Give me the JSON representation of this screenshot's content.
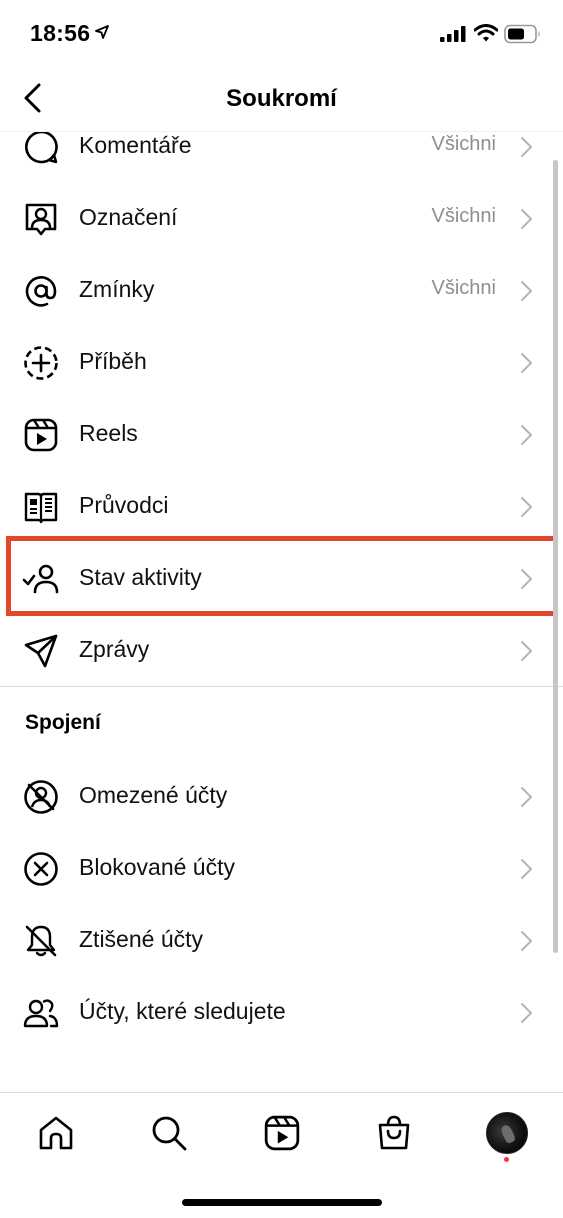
{
  "status_bar": {
    "time": "18:56"
  },
  "header": {
    "title": "Soukromí"
  },
  "rows": [
    {
      "label": "Komentáře",
      "value": "Všichni",
      "icon": "comment-icon"
    },
    {
      "label": "Označení",
      "value": "Všichni",
      "icon": "tag-person-icon"
    },
    {
      "label": "Zmínky",
      "value": "Všichni",
      "icon": "at-icon"
    },
    {
      "label": "Příběh",
      "value": "",
      "icon": "story-add-icon"
    },
    {
      "label": "Reels",
      "value": "",
      "icon": "reels-icon"
    },
    {
      "label": "Průvodci",
      "value": "",
      "icon": "guides-icon"
    },
    {
      "label": "Stav aktivity",
      "value": "",
      "icon": "activity-status-icon"
    },
    {
      "label": "Zprávy",
      "value": "",
      "icon": "send-icon"
    }
  ],
  "connections": {
    "title": "Spojení",
    "rows": [
      {
        "label": "Omezené účty",
        "icon": "restricted-icon"
      },
      {
        "label": "Blokované účty",
        "icon": "blocked-icon"
      },
      {
        "label": "Ztišené účty",
        "icon": "muted-bell-icon"
      },
      {
        "label": "Účty, které sledujete",
        "icon": "following-icon"
      }
    ]
  },
  "tab_bar": {
    "tabs": [
      "home",
      "search",
      "reels",
      "shop",
      "profile"
    ]
  },
  "colors": {
    "highlight": "#e2462d",
    "secondary_text": "#8e8e8e",
    "notification_dot": "#ff3040"
  }
}
